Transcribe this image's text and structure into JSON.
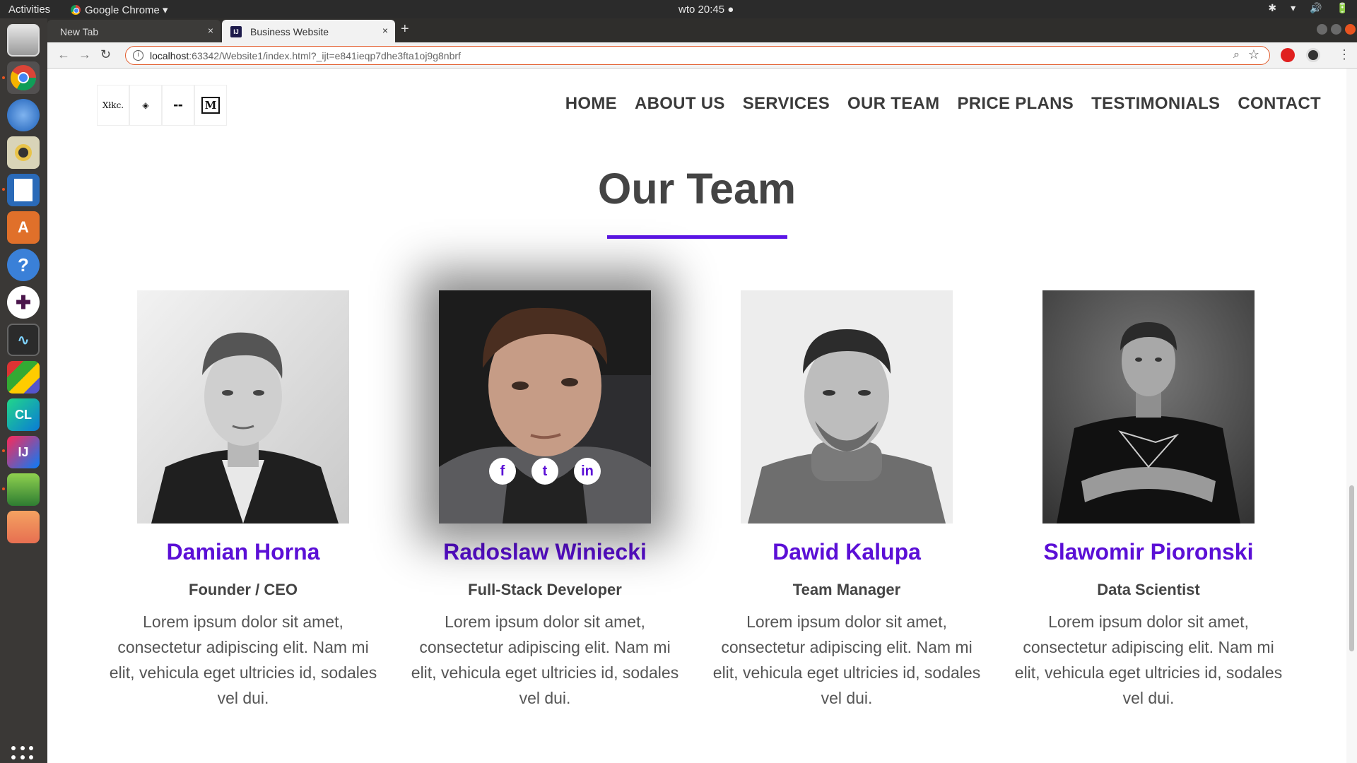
{
  "system": {
    "activities": "Activities",
    "app_name": "Google Chrome ▾",
    "clock": "wto 20:45 ●",
    "tray": [
      "✱",
      "▾",
      "🔊",
      "🔋"
    ]
  },
  "browser": {
    "tabs": [
      {
        "title": "New Tab",
        "close": "×"
      },
      {
        "title": "Business Website",
        "close": "×",
        "favicon": "IJ"
      }
    ],
    "new_tab": "+",
    "url_host": "localhost",
    "url_rest": ":63342/Website1/index.html?_ijt=e841ieqp7dhe3fta1oj9g8nbrf",
    "nav_icons": [
      "←",
      "→",
      "↻"
    ]
  },
  "site": {
    "logos": [
      "Xłkc.",
      "◈",
      "▬▬",
      "M"
    ],
    "nav": [
      "HOME",
      "ABOUT US",
      "SERVICES",
      "OUR TEAM",
      "PRICE PLANS",
      "TESTIMONIALS",
      "CONTACT"
    ],
    "section_title": "Our Team",
    "accent_color": "#5b15e6",
    "members": [
      {
        "name": "Damian Horna",
        "role": "Founder / CEO",
        "bio": "Lorem ipsum dolor sit amet, consectetur adipiscing elit. Nam mi elit, vehicula eget ultricies id, sodales vel dui."
      },
      {
        "name": "Radoslaw Winiecki",
        "role": "Full-Stack Developer",
        "bio": "Lorem ipsum dolor sit amet, consectetur adipiscing elit. Nam mi elit, vehicula eget ultricies id, sodales vel dui.",
        "socials": [
          "f",
          "t",
          "in"
        ]
      },
      {
        "name": "Dawid Kalupa",
        "role": "Team Manager",
        "bio": "Lorem ipsum dolor sit amet, consectetur adipiscing elit. Nam mi elit, vehicula eget ultricies id, sodales vel dui."
      },
      {
        "name": "Slawomir Pioronski",
        "role": "Data Scientist",
        "bio": "Lorem ipsum dolor sit amet, consectetur adipiscing elit. Nam mi elit, vehicula eget ultricies id, sodales vel dui."
      }
    ]
  }
}
